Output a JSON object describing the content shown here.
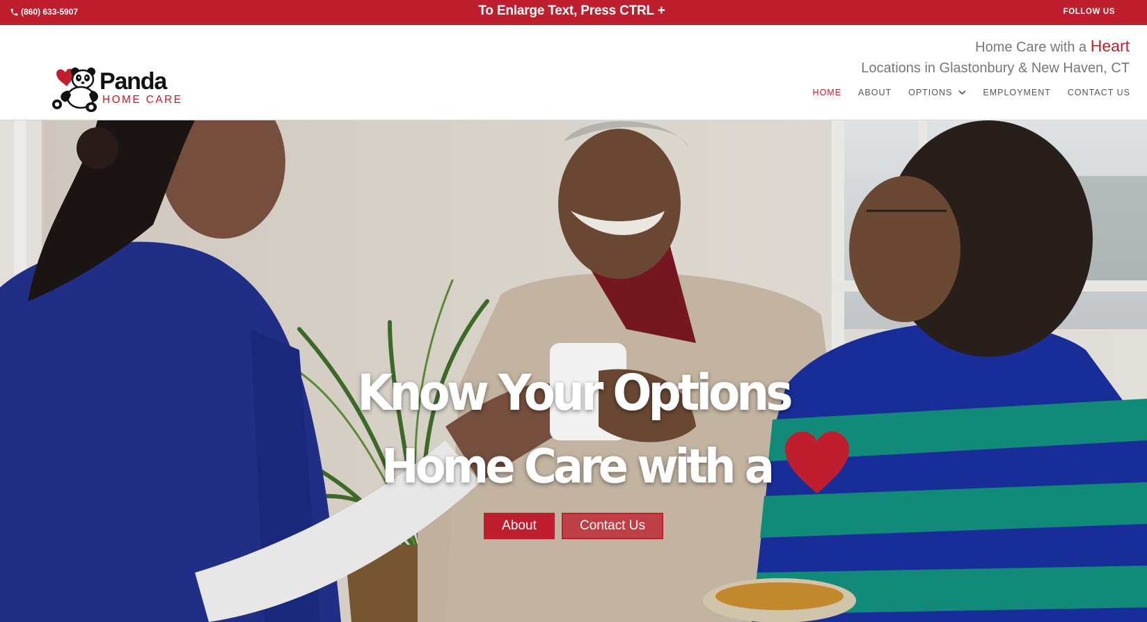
{
  "topbar": {
    "phone": "(860) 633-5907",
    "notice": "To Enlarge Text, Press CTRL +",
    "follow_label": "FOLLOW US"
  },
  "brand": {
    "name": "Panda",
    "sub": "HOME CARE",
    "accent_color": "#be1e2d"
  },
  "tagline": {
    "line1_prefix": "Home Care with a ",
    "line1_highlight": "Heart",
    "line2": "Locations in Glastonbury & New Haven, CT"
  },
  "nav": {
    "items": [
      {
        "label": "HOME",
        "active": true
      },
      {
        "label": "ABOUT"
      },
      {
        "label": "OPTIONS",
        "icon": "chevron-down-icon"
      },
      {
        "label": "EMPLOYMENT"
      },
      {
        "label": "CONTACT US"
      }
    ]
  },
  "hero": {
    "headline": "Know Your Options",
    "subline": "Home Care with a",
    "subline_icon": "heart-icon",
    "buttons": {
      "about": "About",
      "contact": "Contact Us"
    }
  }
}
